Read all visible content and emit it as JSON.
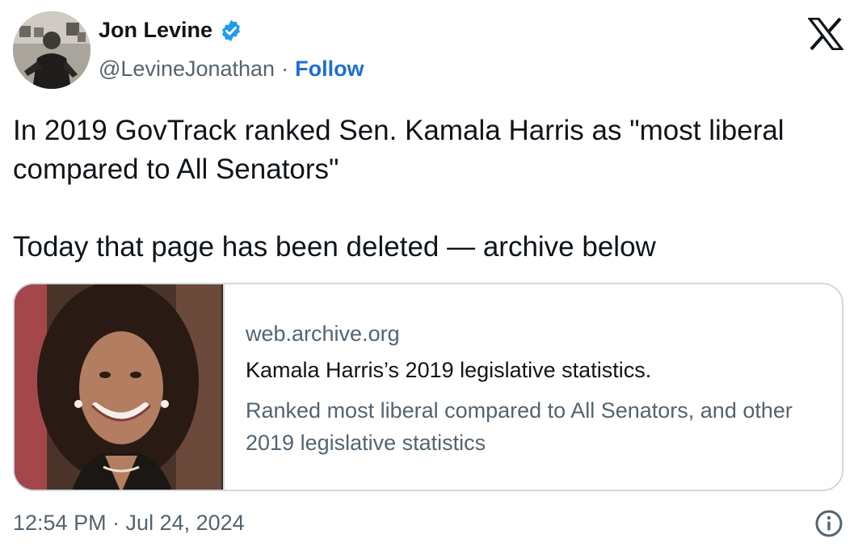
{
  "author": {
    "name": "Jon Levine",
    "handle": "@LevineJonathan",
    "separator": "·",
    "follow_label": "Follow"
  },
  "icons": {
    "verified": "verified-badge-icon",
    "brand": "x-logo-icon",
    "info": "info-icon"
  },
  "tweet": {
    "paragraphs": [
      "In 2019 GovTrack ranked Sen. Kamala Harris as \"most liberal compared to All Senators\"",
      "Today that page has been deleted — archive below"
    ]
  },
  "card": {
    "domain": "web.archive.org",
    "title": "Kamala Harris’s 2019 legislative statistics.",
    "description": "Ranked most liberal compared to All Senators, and other 2019 legislative statistics"
  },
  "timestamp": "12:54 PM · Jul 24, 2024",
  "colors": {
    "accent": "#1d9bf0",
    "follow": "#1d6fd0",
    "secondary_text": "#536471",
    "border": "#cfd9de"
  }
}
